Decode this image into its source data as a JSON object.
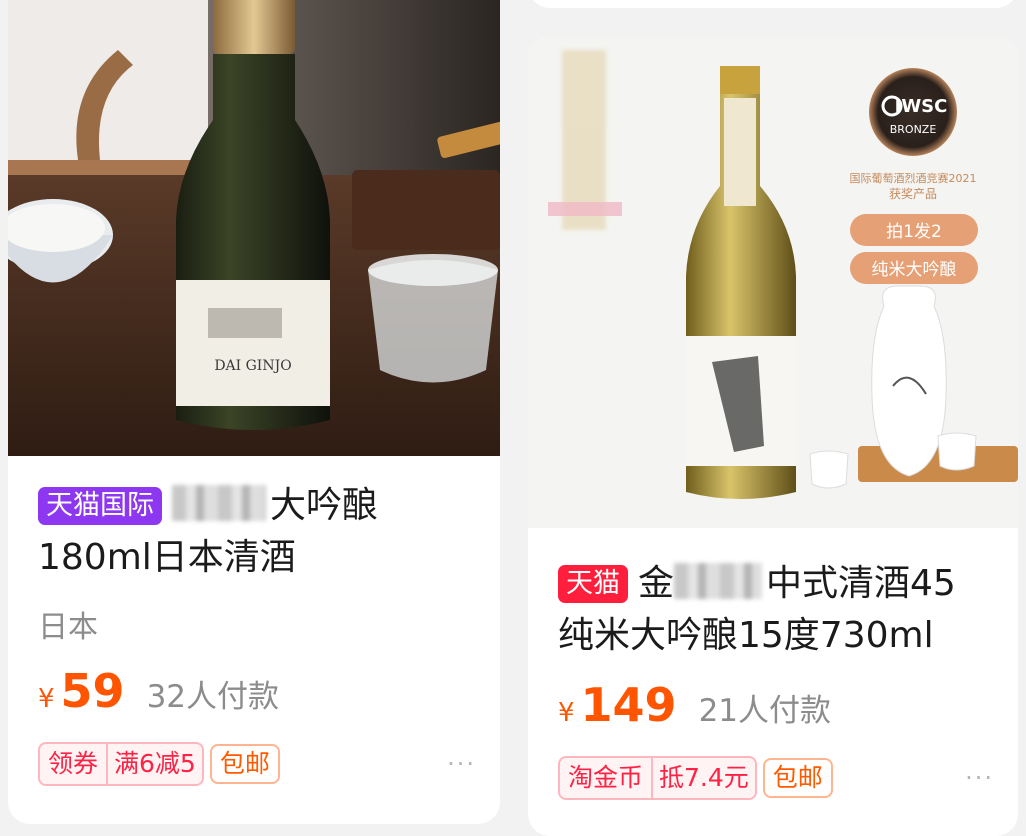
{
  "products": [
    {
      "tag": "天猫国际",
      "title_line1": "大吟酿",
      "title_line2": "180ml日本清酒",
      "origin": "日本",
      "currency": "¥",
      "price": "59",
      "sold": "32人付款",
      "coupon_label": "领券",
      "coupon_value": "满6减5",
      "shipping": "包邮",
      "more": "···",
      "photo": {
        "label_text": "DAI GINJO"
      }
    },
    {
      "tag": "天猫",
      "title_prefix": "金",
      "title_line1": "中式清酒45",
      "title_line2": "纯米大吟酿15度730ml",
      "currency": "¥",
      "price": "149",
      "sold": "21人付款",
      "coupon_label": "淘金币",
      "coupon_value": "抵7.4元",
      "shipping": "包邮",
      "more": "···",
      "photo": {
        "award_brand": "IWSC",
        "award_level": "BRONZE",
        "award_caption": "国际葡萄酒烈酒竞赛2021",
        "award_caption2": "获奖产品",
        "promo1": "拍1发2",
        "promo2": "纯米大吟酿"
      }
    }
  ],
  "colors": {
    "price": "#ff5400",
    "tmall_intl": "#8d37f1",
    "tmall": "#ff1f3c"
  }
}
